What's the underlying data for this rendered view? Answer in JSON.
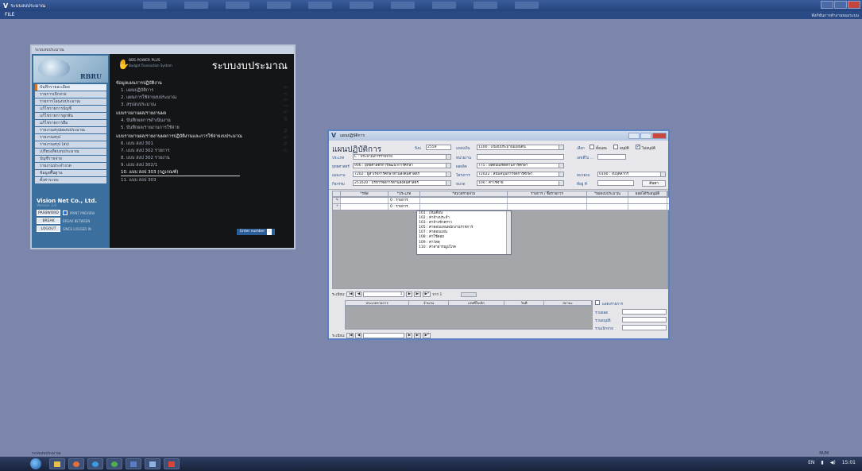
{
  "app": {
    "title": "ระบบงบประมาณ",
    "logo": "V",
    "menu_file": "FILE",
    "status_right": "ฟังก์ชันการทำงานของระบบ",
    "bottom_status": "ระบบงบประมาณ",
    "num": "NUM"
  },
  "menu_window": {
    "title": "ระบบงบประมาณ",
    "logo_text": "RBRU",
    "sidebar_items": [
      "บันทึกรายละเอียด",
      "รายการเบิกจ่าย",
      "รายการโอนงบประมาณ",
      "แก้ไขรายการบัญชี",
      "แก้ไขรายการผูกพัน",
      "แก้ไขรายการยืม",
      "รายงานสรุปผลงบประมาณ",
      "รายงานสรุป",
      "รายงานสรุป (ส่ง)",
      "เปรียบเทียบงบประมาณ",
      "บัญชีรายจ่าย",
      "รายงานประจำงวด",
      "ข้อมูลพื้นฐาน",
      "ตั้งค่าระบบ"
    ],
    "company": "Vision Net Co., Ltd.",
    "version": "Version 3.0",
    "password_btn": "PASSWORD",
    "print_preview": "PRINT PREVIEW",
    "break_btn": "BREAK",
    "break_lbl": "BREAK BETWEEN",
    "logout_btn": "LOGOUT",
    "logout_lbl": "SINCE LOGGED IN",
    "header_sub1": "BBS POWER PLUS",
    "header_sub2": "Budget Transaction System",
    "header_title": "ระบบงบประมาณ",
    "section1": "ข้อมูลแผนการปฏิบัติงาน",
    "items1": [
      "1. แผนปฏิบัติการ",
      "2. แผนการใช้จ่ายงบประมาณ",
      "3. สรุปงบประมาณ"
    ],
    "section2": "แบบรายงานผล/รายงานผล",
    "items2": [
      "4. บันทึกผลการดำเนินงาน",
      "5. บันทึกผล/รายงานการใช้จ่าย"
    ],
    "section3": "แบบรายงานผล/รายงานผลการปฏิบัติงานและการใช้จ่ายงบประมาณ",
    "items3": [
      "6. แบบ สงป 301",
      "7. แบบ สงป 302 รายการ",
      "8. แบบ สงป 302 รายงาน",
      "9. แบบ สงป 302/1",
      "10. แบบ สงป 303 (กฎเกณฑ์)",
      "11. แบบ สงป 303"
    ],
    "vertical_text": "SYSTEM MENU",
    "enter_btn": "Enter number"
  },
  "form_window": {
    "title": "แผนปฏิบัติการ",
    "label_big": "แผนปฏิบัติการ",
    "fields": {
      "year_lbl": "ปีงบ",
      "year": "2559",
      "source_lbl": "แหล่งเงิน",
      "source": "1100 : เงินงบประมาณแผ่นดิน",
      "select_lbl": "เลือก",
      "chk1": "ตั้งแผน",
      "chk2": "อนุมัติ",
      "chk3": "ไม่อนุมัติ",
      "type_lbl": "ประเภท",
      "type": "C : ประมาณการรายจ่าย",
      "agency_lbl": "หน่วยงาน",
      "doc_lbl": "เลขที่ใบ ...",
      "strategy_lbl": "ยุทธศาสตร์",
      "strategy": "906 : ยุทธศาสตร์การพัฒนาการศึกษา",
      "output_lbl": "ผลผลิต",
      "output": "775 : ผลิตบัณฑิตด้านการศึกษา",
      "plan_lbl": "แผนงาน",
      "plan": "7202 : ผู้สำเร็จการศึกษาด้านสังคมศาสตร์",
      "project_lbl": "โครงการ",
      "project": "72022 : สนับสนุนการจัดการศึกษา",
      "budget_type_lbl": "หมวดงบ",
      "budget_type": "0100 : งบบุคลากร",
      "activity_lbl": "กิจกรรม",
      "activity": "251020 : บริหารจัดการด้านสังคมศาสตร์",
      "category_lbl": "หมวด",
      "category": "100 : ค่าใช้จ่าย",
      "doc2_lbl": "ที่อยู่ ที่",
      "search_btn": "ค้นหา"
    },
    "grid_headers": [
      "*รหัส",
      "*ประเภท",
      "*หมวดรายจ่าย",
      "รายการ / ชื่อรายการ",
      "*ยอดงบประมาณ",
      "ยอดได้รับอนุมัติ"
    ],
    "grid_rows": [
      {
        "mark": "✎",
        "code": "",
        "type": "0 : รายการ",
        "category": ""
      },
      {
        "mark": "*",
        "code": "",
        "type": "0 : รายการ",
        "category": ""
      }
    ],
    "popup_items": [
      "101 : เงินเดือน",
      "102 : ค่าจ้างประจำ",
      "103 : ค่าจ้างชั่วคราว",
      "105 : ค่าตอบแทนพนักงานราชการ",
      "107 : ค่าตอบแทน",
      "108 : ค่าใช้สอย",
      "109 : ค่าวัสดุ",
      "110 : ค่าสาธารณูปโภค"
    ],
    "nav_label": "ระเบียน:",
    "nav_text": "1",
    "nav_of": "จาก 1",
    "sub_grid_headers": [
      "ประเภทรายการ",
      "จำนวน",
      "เลขที่ใบเบิก",
      "วันที่",
      "สถานะ"
    ],
    "summary": {
      "chk_lbl": "แสดงรายการ",
      "total_lbl": "รวมยอด",
      "approved_lbl": "รวมอนุมัติ",
      "paid_lbl": "รวมเบิกจ่าย"
    },
    "nav2_label": "ระเบียน:"
  },
  "taskbar": {
    "lang": "EN",
    "time": "15:01"
  }
}
